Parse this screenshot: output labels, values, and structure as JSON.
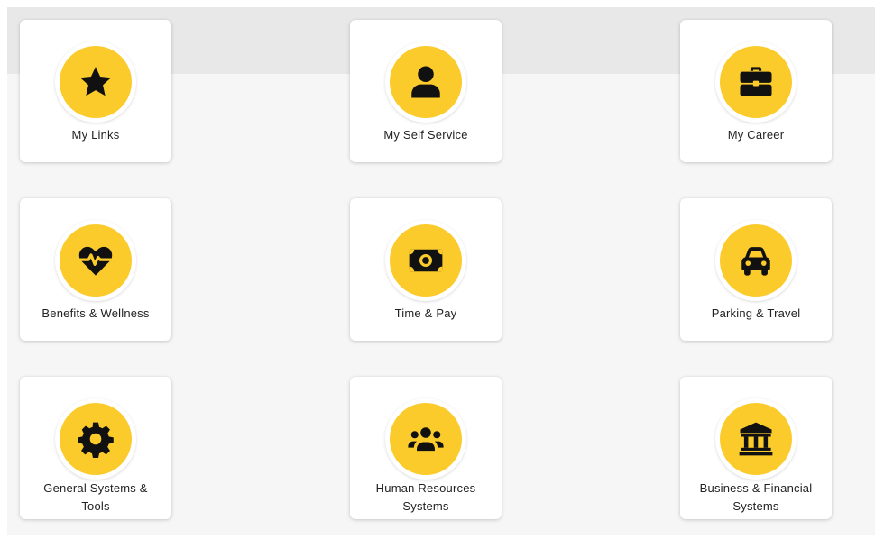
{
  "colors": {
    "accent": "#fbcb2c",
    "tile_background": "#ffffff",
    "page_background": "#f6f6f6",
    "header_band": "#e8e8e8",
    "icon_color": "#111111",
    "text_color": "#222222"
  },
  "tiles": [
    {
      "id": "my-links",
      "icon": "star-icon",
      "lines": [
        "My Links"
      ]
    },
    {
      "id": "my-self-service",
      "icon": "user-icon",
      "lines": [
        "My Self Service"
      ]
    },
    {
      "id": "my-career",
      "icon": "briefcase-icon",
      "lines": [
        "My Career"
      ]
    },
    {
      "id": "benefits-wellness",
      "icon": "heartbeat-icon",
      "lines": [
        "Benefits & Wellness"
      ]
    },
    {
      "id": "time-pay",
      "icon": "money-bill-icon",
      "lines": [
        "Time & Pay"
      ]
    },
    {
      "id": "parking-travel",
      "icon": "car-icon",
      "lines": [
        "Parking & Travel"
      ]
    },
    {
      "id": "general-systems-tools",
      "icon": "cog-icon",
      "lines": [
        "General Systems &",
        "Tools"
      ]
    },
    {
      "id": "human-resources-systems",
      "icon": "users-icon",
      "lines": [
        "Human Resources",
        "Systems"
      ]
    },
    {
      "id": "business-financial-systems",
      "icon": "bank-icon",
      "lines": [
        "Business & Financial",
        "Systems"
      ]
    }
  ]
}
